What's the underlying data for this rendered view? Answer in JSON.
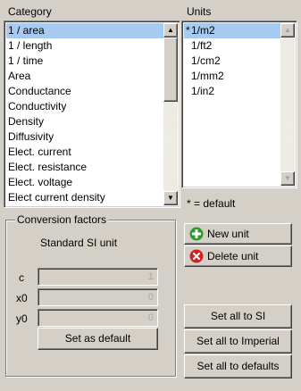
{
  "category": {
    "label": "Category",
    "items": [
      "1 / area",
      "1 / length",
      "1 / time",
      "Area",
      "Conductance",
      "Conductivity",
      "Density",
      "Diffusivity",
      "Elect. current",
      "Elect. resistance",
      "Elect. voltage",
      "Elect current density"
    ],
    "selected_index": 0
  },
  "units": {
    "label": "Units",
    "items": [
      {
        "mark": "*",
        "name": "1/m2"
      },
      {
        "mark": "",
        "name": "1/ft2"
      },
      {
        "mark": "",
        "name": "1/cm2"
      },
      {
        "mark": "",
        "name": "1/mm2"
      },
      {
        "mark": "",
        "name": "1/in2"
      }
    ],
    "selected_index": 0,
    "default_note": "* = default"
  },
  "conversion": {
    "title": "Conversion factors",
    "standard_label": "Standard SI unit",
    "fields": [
      {
        "label": "c",
        "value": "1"
      },
      {
        "label": "x0",
        "value": "0"
      },
      {
        "label": "y0",
        "value": "0"
      }
    ],
    "set_default_label": "Set as default"
  },
  "buttons": {
    "new_unit": "New unit",
    "delete_unit": "Delete unit",
    "set_si": "Set all to SI",
    "set_imperial": "Set all to Imperial",
    "set_defaults": "Set all to defaults"
  },
  "icons": {
    "new_unit": "plus-icon",
    "delete_unit": "x-icon"
  },
  "colors": {
    "background": "#d4d0c8",
    "selection": "#a6caf0",
    "new_icon": "#2e9a2e",
    "delete_icon": "#d42020"
  }
}
